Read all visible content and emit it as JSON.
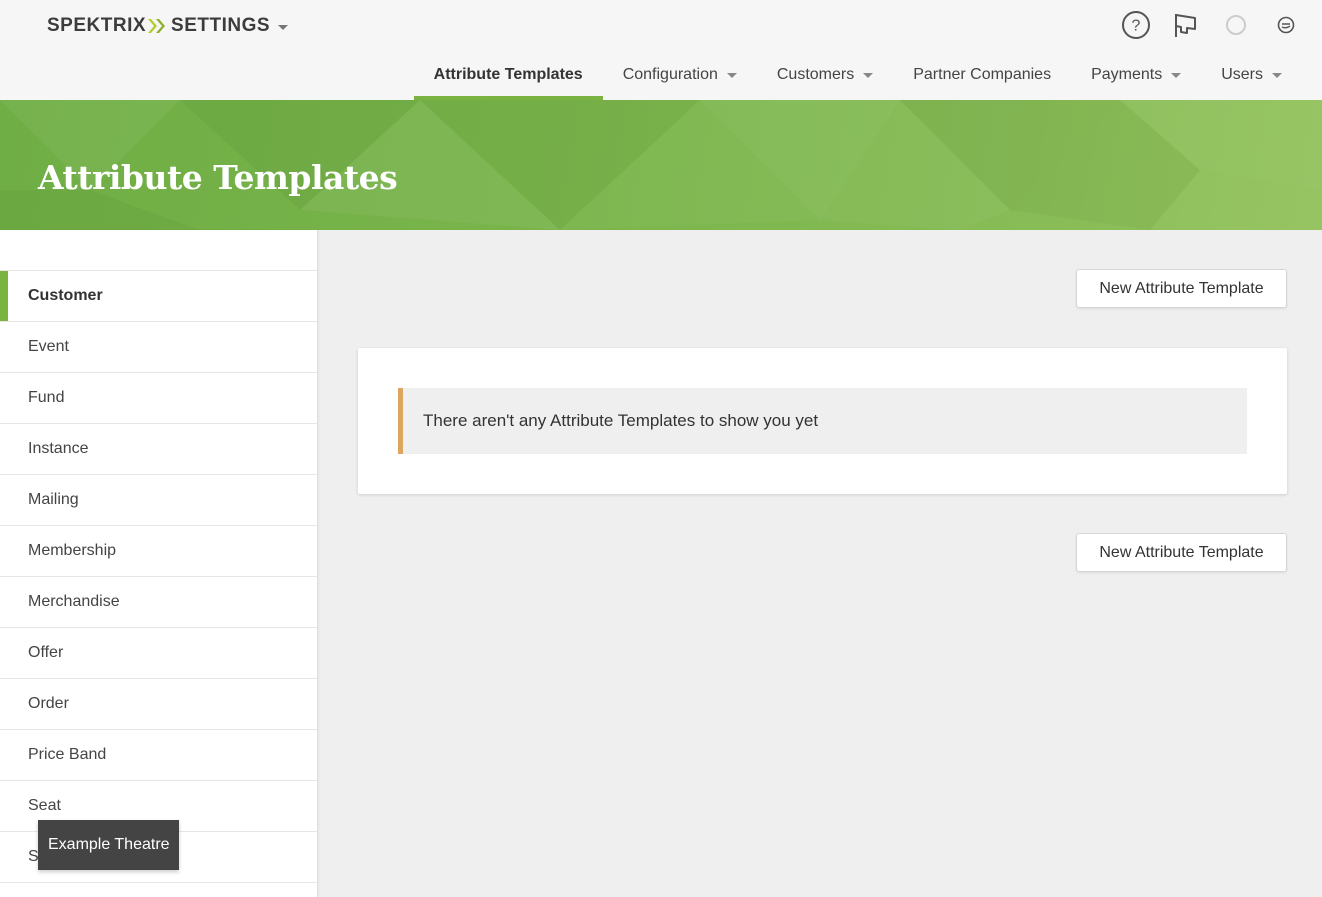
{
  "app": {
    "brand_left": "SPEKTRIX",
    "brand_right": "SETTINGS",
    "accent_color": "#7ab342",
    "brand_chevron_color": "#b5cc2e"
  },
  "top_icons": [
    "help-icon",
    "announcement-icon",
    "status-icon",
    "account-icon"
  ],
  "nav": {
    "items": [
      {
        "label": "Attribute Templates",
        "active": true,
        "dropdown": false
      },
      {
        "label": "Configuration",
        "dropdown": true
      },
      {
        "label": "Customers",
        "dropdown": true
      },
      {
        "label": "Partner Companies",
        "dropdown": false
      },
      {
        "label": "Payments",
        "dropdown": true
      },
      {
        "label": "Users",
        "dropdown": true
      }
    ]
  },
  "banner": {
    "title": "Attribute Templates"
  },
  "sidebar": {
    "items": [
      {
        "label": "Customer",
        "active": true
      },
      {
        "label": "Event"
      },
      {
        "label": "Fund"
      },
      {
        "label": "Instance"
      },
      {
        "label": "Mailing"
      },
      {
        "label": "Membership"
      },
      {
        "label": "Merchandise"
      },
      {
        "label": "Offer"
      },
      {
        "label": "Order"
      },
      {
        "label": "Price Band"
      },
      {
        "label": "Seat"
      },
      {
        "label": "S"
      }
    ]
  },
  "tooltip": {
    "text": "Example Theatre"
  },
  "main": {
    "new_button_label": "New Attribute Template",
    "empty_message": "There aren't any Attribute Templates to show you yet",
    "notice_border_color": "#dca661"
  }
}
